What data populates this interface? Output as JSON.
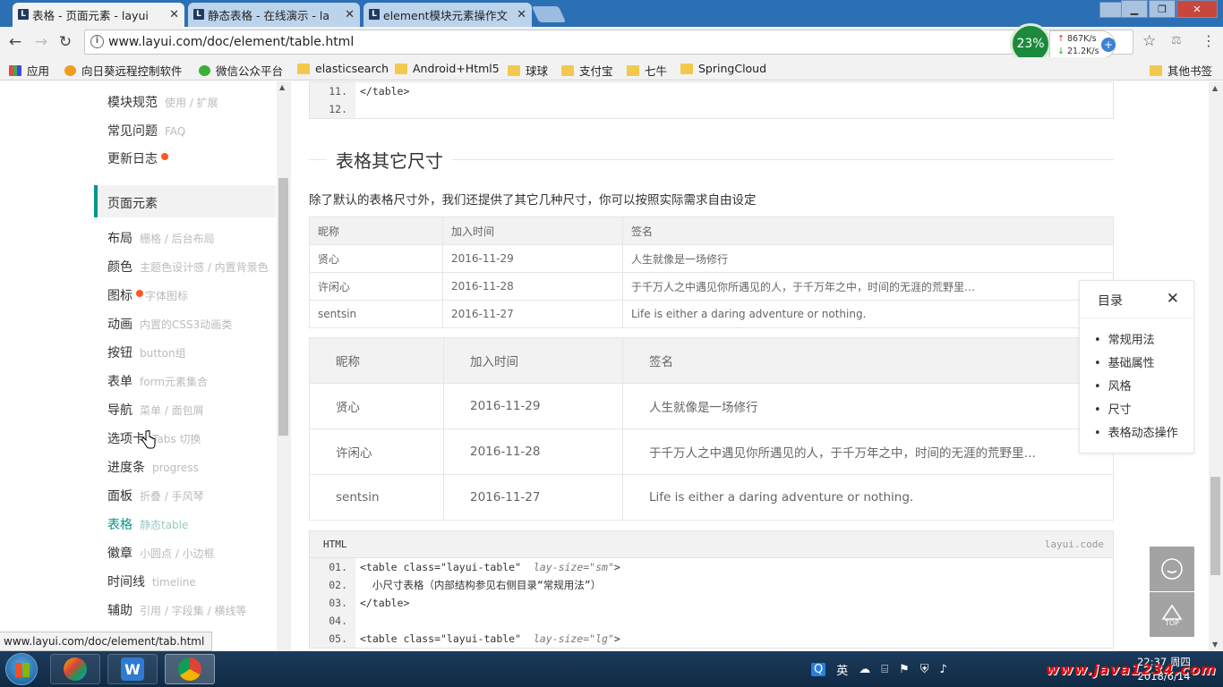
{
  "browser": {
    "tabs": [
      {
        "title": "表格 - 页面元素 - layui"
      },
      {
        "title": "静态表格 - 在线演示 - la"
      },
      {
        "title": "element模块元素操作文"
      }
    ],
    "url": "www.layui.com/doc/element/table.html",
    "status_url": "www.layui.com/doc/element/tab.html",
    "speed": {
      "percent": "23%",
      "up": "867K/s",
      "down": "21.2K/s"
    },
    "bookmarks": [
      "应用",
      "向日葵远程控制软件",
      "微信公众平台",
      "elasticsearch",
      "Android+Html5",
      "球球",
      "支付宝",
      "七牛",
      "SpringCloud"
    ],
    "other_bookmarks": "其他书签"
  },
  "sidebar": {
    "top_items": [
      {
        "label": "模块规范",
        "sub": "使用 / 扩展"
      },
      {
        "label": "常见问题",
        "sub": "FAQ"
      },
      {
        "label": "更新日志",
        "sub": ""
      }
    ],
    "group": "页面元素",
    "items": [
      {
        "label": "布局",
        "sub": "栅格 / 后台布局"
      },
      {
        "label": "颜色",
        "sub": "主题色设计感 / 内置背景色"
      },
      {
        "label": "图标",
        "sub": "字体图标"
      },
      {
        "label": "动画",
        "sub": "内置的CSS3动画类"
      },
      {
        "label": "按钮",
        "sub": "button组"
      },
      {
        "label": "表单",
        "sub": "form元素集合"
      },
      {
        "label": "导航",
        "sub": "菜单 / 面包屑"
      },
      {
        "label": "选项卡",
        "sub": "Tabs 切换"
      },
      {
        "label": "进度条",
        "sub": "progress"
      },
      {
        "label": "面板",
        "sub": "折叠 / 手风琴"
      },
      {
        "label": "表格",
        "sub": "静态table"
      },
      {
        "label": "徽章",
        "sub": "小圆点 / 小边框"
      },
      {
        "label": "时间线",
        "sub": "timeline"
      },
      {
        "label": "辅助",
        "sub": "引用 / 字段集 / 横线等"
      }
    ]
  },
  "main": {
    "code_top": [
      {
        "ln": "11.",
        "code": "</table>"
      },
      {
        "ln": "12.",
        "code": ""
      }
    ],
    "section_title": "表格其它尺寸",
    "description": "除了默认的表格尺寸外，我们还提供了其它几种尺寸，你可以按照实际需求自由设定",
    "table_headers": [
      "昵称",
      "加入时间",
      "签名"
    ],
    "table_rows": [
      [
        "贤心",
        "2016-11-29",
        "人生就像是一场修行"
      ],
      [
        "许闲心",
        "2016-11-28",
        "于千万人之中遇见你所遇见的人，于千万年之中，时间的无涯的荒野里…"
      ],
      [
        "sentsin",
        "2016-11-27",
        "Life is either a daring adventure or nothing."
      ]
    ],
    "code_block": {
      "lang": "HTML",
      "brand": "layui.code",
      "lines": [
        {
          "ln": "01.",
          "pre": "<table class=\"layui-table\"  ",
          "attr": "lay-size=\"sm\"",
          "post": ">"
        },
        {
          "ln": "02.",
          "pre": "  小尺寸表格（内部结构参见右侧目录“常规用法”）",
          "attr": "",
          "post": ""
        },
        {
          "ln": "03.",
          "pre": "</table>",
          "attr": "",
          "post": ""
        },
        {
          "ln": "04.",
          "pre": "",
          "attr": "",
          "post": ""
        },
        {
          "ln": "05.",
          "pre": "<table class=\"layui-table\"  ",
          "attr": "lay-size=\"lg\"",
          "post": ">"
        }
      ]
    }
  },
  "toc": {
    "title": "目录",
    "items": [
      "常规用法",
      "基础属性",
      "风格",
      "尺寸",
      "表格动态操作"
    ]
  },
  "fixbar": {
    "top_label": "TOP"
  },
  "taskbar": {
    "ime": "英",
    "time": "22:37 周四",
    "date": "2018/6/14",
    "watermark": "www.java1234.com"
  }
}
